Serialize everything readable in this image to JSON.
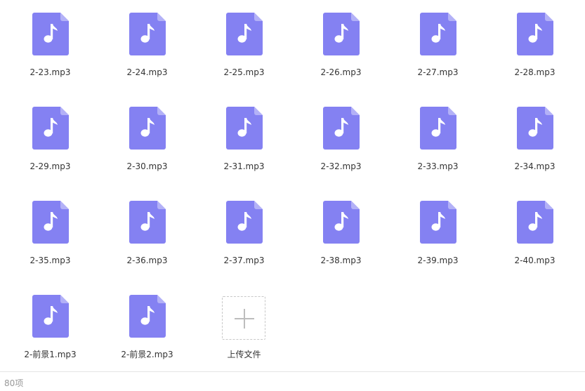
{
  "icon_color": "#8481f2",
  "icon_fold_color": "#b3b1f7",
  "file_icon": "music-note-icon",
  "files": [
    "2-23.mp3",
    "2-24.mp3",
    "2-25.mp3",
    "2-26.mp3",
    "2-27.mp3",
    "2-28.mp3",
    "2-29.mp3",
    "2-30.mp3",
    "2-31.mp3",
    "2-32.mp3",
    "2-33.mp3",
    "2-34.mp3",
    "2-35.mp3",
    "2-36.mp3",
    "2-37.mp3",
    "2-38.mp3",
    "2-39.mp3",
    "2-40.mp3",
    "2-前景1.mp3",
    "2-前景2.mp3"
  ],
  "upload": {
    "label": "上传文件",
    "icon": "plus-icon"
  },
  "footer": {
    "count": "80项"
  }
}
